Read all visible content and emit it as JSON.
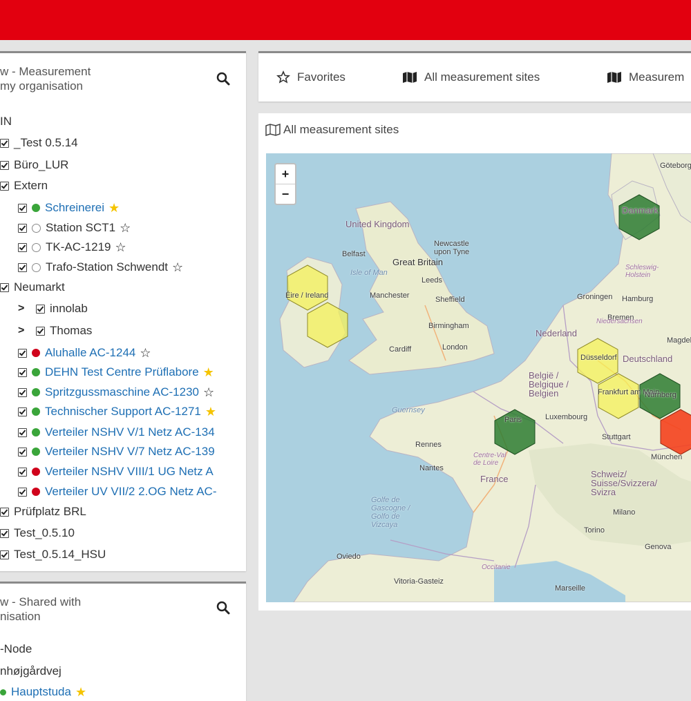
{
  "tree_panel": {
    "title": "w - Measurement\nmy organisation",
    "rows": [
      {
        "label": "IN",
        "type": "root"
      },
      {
        "label": "_Test 0.5.14",
        "type": "group"
      },
      {
        "label": "Büro_LUR",
        "type": "group"
      },
      {
        "label": "Extern",
        "type": "group"
      },
      {
        "label": "Schreinerei",
        "status": "green",
        "star": "filled",
        "type": "site"
      },
      {
        "label": "Station SCT1",
        "status": "empty",
        "star": "outline",
        "type": "site"
      },
      {
        "label": "TK-AC-1219",
        "status": "empty",
        "star": "outline",
        "type": "site"
      },
      {
        "label": "Trafo-Station Schwendt",
        "status": "empty",
        "star": "outline",
        "type": "site"
      },
      {
        "label": "Neumarkt",
        "type": "group"
      },
      {
        "label": "innolab",
        "type": "subgroup"
      },
      {
        "label": "Thomas",
        "type": "subgroup"
      },
      {
        "label": "Aluhalle AC-1244",
        "status": "red",
        "star": "outline",
        "type": "site"
      },
      {
        "label": "DEHN Test Centre Prüflabore",
        "status": "green",
        "star": "filled",
        "type": "site"
      },
      {
        "label": "Spritzgussmaschine AC-1230",
        "status": "green",
        "star": "outline",
        "type": "site"
      },
      {
        "label": "Technischer Support AC-1271",
        "status": "green",
        "star": "filled",
        "type": "site"
      },
      {
        "label": "Verteiler NSHV V/1 Netz AC-134",
        "status": "green",
        "star": "none",
        "type": "site"
      },
      {
        "label": "Verteiler NSHV V/7 Netz AC-139",
        "status": "green",
        "star": "none",
        "type": "site"
      },
      {
        "label": "Verteiler NSHV VIII/1 UG Netz A",
        "status": "red",
        "star": "none",
        "type": "site"
      },
      {
        "label": "Verteiler UV VII/2 2.OG Netz AC-",
        "status": "red",
        "star": "none",
        "type": "site"
      },
      {
        "label": "Prüfplatz BRL",
        "type": "group"
      },
      {
        "label": "Test_0.5.10",
        "type": "group"
      },
      {
        "label": "Test_0.5.14_HSU",
        "type": "group"
      }
    ]
  },
  "shared_panel": {
    "title": "w - Shared with\nnisation",
    "rows": [
      "-Node",
      "nhøjgårdvej",
      "Hauptstuda"
    ]
  },
  "tabs": {
    "favorites": "Favorites",
    "all_sites": "All measurement sites",
    "measurement": "Measurem"
  },
  "map_panel": {
    "title": "All measurement sites",
    "zoom_in": "+",
    "zoom_out": "−",
    "labels": {
      "uk": "United Kingdom",
      "great_britain": "Great Britain",
      "belfast": "Belfast",
      "isle_of_man": "Isle of Man",
      "newcastle": "Newcastle\nupon Tyne",
      "leeds": "Leeds",
      "manchester": "Manchester",
      "sheffield": "Sheffield",
      "birmingham": "Birmingham",
      "london": "London",
      "cardiff": "Cardiff",
      "eire": "Éire / Ireland",
      "guernsey": "Guernsey",
      "rennes": "Rennes",
      "nantes": "Nantes",
      "paris": "Paris",
      "centre": "Centre-Val\nde Loire",
      "france": "France",
      "golfe": "Golfe de\nGascogne /\nGolfo de\nVizcaya",
      "oviedo": "Oviedo",
      "vitoria": "Vitoria-Gasteiz",
      "occitanie": "Occitanie",
      "nederland": "Nederland",
      "belgique": "België /\nBelgique /\nBelgien",
      "luxembourg": "Luxembourg",
      "stuttgart": "Stuttgart",
      "muenchen": "München",
      "schweiz": "Schweiz/\nSuisse/Svizzera/\nSvizra",
      "milano": "Milano",
      "genova": "Genova",
      "deutschland": "Deutschland",
      "hamburg": "Hamburg",
      "groningen": "Groningen",
      "bremen": "Bremen",
      "magdeburg": "Magdeburg",
      "niedersachsen": "Niedersachsen",
      "danmark": "Danmark",
      "goteborg": "Göteborg",
      "schleswig": "Schleswig-\nHolstein",
      "duesseldorf": "Düsseldorf",
      "frankfurt": "Frankfurt am Main",
      "nuernberg": "Nürnberg",
      "marseille": "Marseille",
      "torino": "Torino"
    }
  },
  "colors": {
    "header_red": "#e2000f",
    "hex_green": "#2e7d32",
    "hex_yellow": "#f4f15a",
    "hex_red": "#f4411e",
    "link_blue": "#1e6fb4",
    "star_yellow": "#f5c400"
  }
}
